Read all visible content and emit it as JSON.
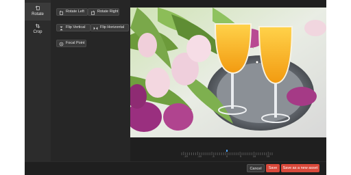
{
  "sidebar": {
    "items": [
      {
        "label": "Rotate",
        "icon": "rotate-icon"
      },
      {
        "label": "Crop",
        "icon": "crop-icon"
      }
    ]
  },
  "panel": {
    "rotate_left": "Rotate Left",
    "rotate_right": "Rotate Right",
    "flip_vertical": "Flip Vertical",
    "flip_horizontal": "Flip Horizontal",
    "focal_point": "Focal Point"
  },
  "ruler": {
    "labels": [
      "-15",
      "-10",
      "-5",
      "0",
      "5",
      "10",
      "15"
    ],
    "current_value": 0
  },
  "footer": {
    "cancel": "Cancel",
    "save": "Save",
    "save_new": "Save as a new asset"
  },
  "colors": {
    "accent": "#d9483a",
    "marker": "#4da3ff"
  }
}
